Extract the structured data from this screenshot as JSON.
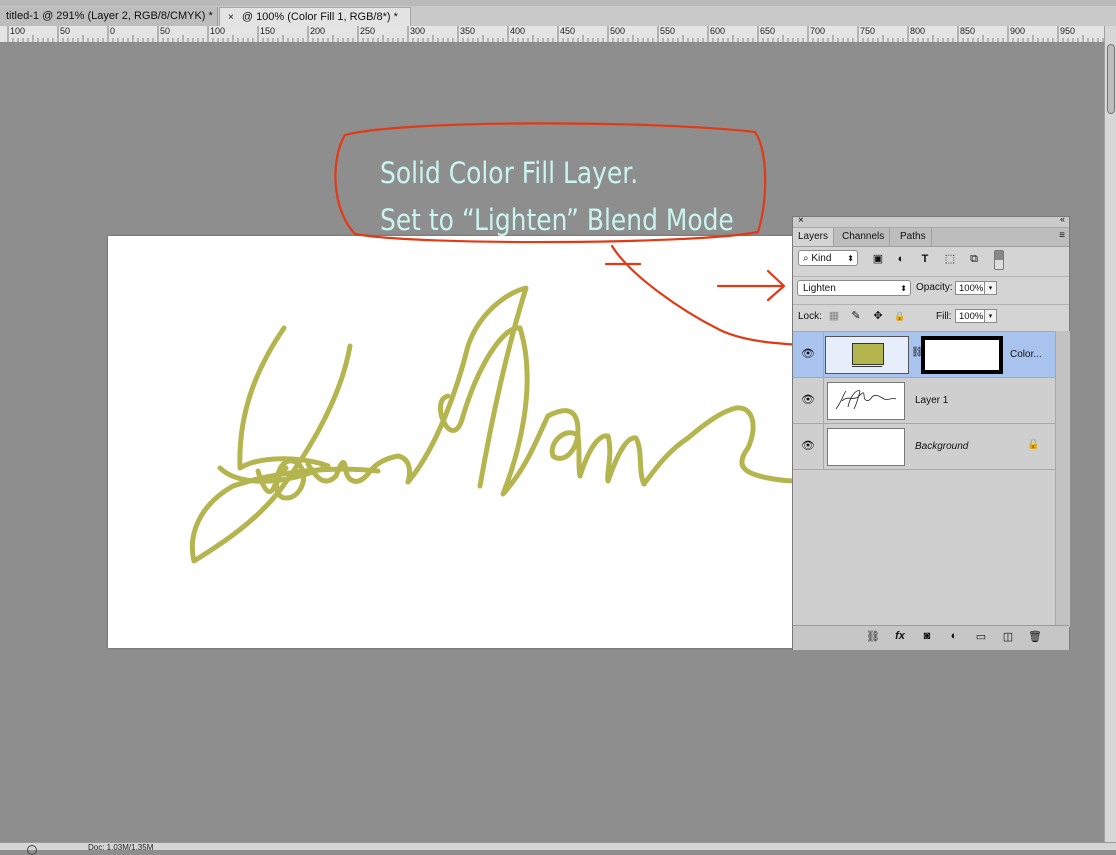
{
  "tabs": [
    {
      "label": "titled-1 @ 291% (Layer 2, RGB/8/CMYK) *",
      "active": false
    },
    {
      "close": "×",
      "label": "@ 100% (Color Fill 1, RGB/8*) *",
      "active": true
    }
  ],
  "ruler": {
    "labels": [
      "100",
      "50",
      "0",
      "50",
      "100",
      "150",
      "200",
      "250",
      "300",
      "350",
      "400",
      "450",
      "500",
      "550",
      "600",
      "650",
      "700",
      "750",
      "800",
      "850",
      "900",
      "950"
    ]
  },
  "annotation": {
    "line1": "Solid Color Fill Layer.",
    "line2": "Set to “Lighten” Blend Mode",
    "text_color": "#c9f5ee",
    "stroke_color": "#e23a14"
  },
  "canvas": {
    "signature_color": "#b5b550"
  },
  "layers_panel": {
    "tabs": [
      "Layers",
      "Channels",
      "Paths"
    ],
    "filter_kind": "Kind",
    "blend_mode": "Lighten",
    "opacity_label": "Opacity:",
    "opacity": "100%",
    "lock_label": "Lock:",
    "fill_label": "Fill:",
    "fill": "100%",
    "layers": [
      {
        "name": "Color...",
        "selected": true,
        "swatch": "#b5b550"
      },
      {
        "name": "Layer 1",
        "selected": false
      },
      {
        "name": "Background",
        "selected": false,
        "locked": true
      }
    ],
    "icons": {
      "close": "×",
      "collapse": "«",
      "menu": "≡",
      "search": "⌕",
      "dropdown": "⬍",
      "small_dropdown": "▾",
      "image_filter": "▣",
      "adjustment_filter": "◐",
      "type_filter": "T",
      "shape_filter": "⬚",
      "smart_filter": "⧉",
      "lock_pixels": "▦",
      "lock_paint": "✎",
      "lock_move": "✥",
      "lock_all": "🔒",
      "eye": "👁",
      "chain": "⛓",
      "link": "⛓",
      "fx": "fx",
      "mask": "◙",
      "adjustment": "◐",
      "folder": "▭",
      "new_layer": "◫",
      "trash": "🗑"
    }
  },
  "status": {
    "doc": "Doc: 1.03M/1.35M"
  }
}
